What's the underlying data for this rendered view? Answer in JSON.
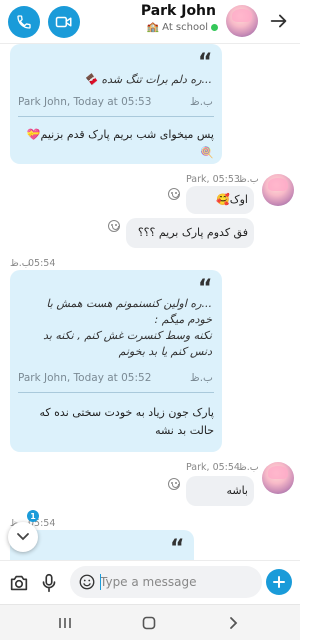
{
  "header": {
    "contact_name": "Park John",
    "status_text": "At school",
    "status_emoji": "🏫",
    "buttons": [
      "phone-icon",
      "video-camera-icon",
      "forward-icon"
    ]
  },
  "messages": {
    "m1": {
      "quote_text": "...ره دلم برات تنگ شده 🍫",
      "quote_meta": "Park John, Today at 05:53",
      "quote_time_fa": "ب.ظ",
      "reply_text": "پس میخوای شب بریم پارک قدم بزنیم💝🍭"
    },
    "m2": {
      "meta": "Park, 05:53",
      "meta_fa": "ب.ظ",
      "text": "اوک🥰"
    },
    "m3": {
      "text": "فق کدوم پارک بریم ؟؟؟"
    },
    "m4": {
      "time": "05:54",
      "time_fa": "ب.ظ",
      "quote_line1": "...ره اولین کنسنمونم هست همش با",
      "quote_line2": "خودم میگم :",
      "quote_line3": "نکنه وسط کنسرت غش کنم , نکنه بد",
      "quote_line4": "دنس کنم یا بد بخونم",
      "quote_meta": "Park John, Today at 05:52",
      "quote_time_fa": "ب.ظ",
      "reply_line1": "پارک جون زیاد به خودت سختی نده که",
      "reply_line2": "حالت بد نشه"
    },
    "m5": {
      "meta": "Park, 05:54",
      "meta_fa": "ب.ظ",
      "text": "باشه"
    },
    "m6": {
      "time": "05:54",
      "time_fa": "ب.ظ"
    }
  },
  "scroll": {
    "badge_count": "1"
  },
  "composer": {
    "placeholder": "Type a message"
  },
  "colors": {
    "accent": "#1a9bd9",
    "quote_bubble": "#dcf1fb",
    "plain_bubble": "#eef0f3",
    "online": "#34c759"
  }
}
